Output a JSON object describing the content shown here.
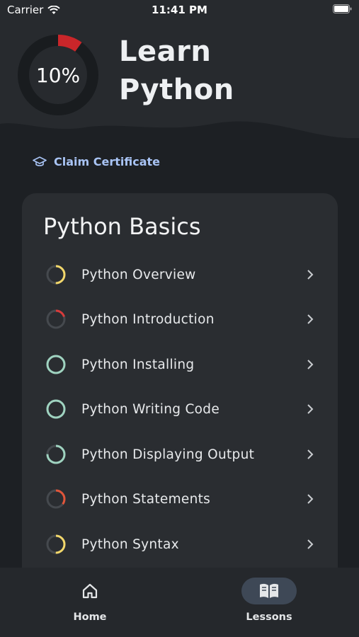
{
  "status_bar": {
    "carrier": "Carrier",
    "time": "11:41 PM"
  },
  "course": {
    "title_line1": "Learn",
    "title_line2": "Python",
    "progress_label": "10%",
    "progress": 0.1
  },
  "claim": {
    "label": "Claim Certificate"
  },
  "section": {
    "title": "Python Basics",
    "lessons": [
      {
        "label": "Python Overview",
        "progress": 0.5,
        "color": "#f2d76b"
      },
      {
        "label": "Python Introduction",
        "progress": 0.2,
        "color": "#d93b3b"
      },
      {
        "label": "Python Installing",
        "progress": 1.0,
        "color": "#9fd3c0"
      },
      {
        "label": "Python Writing Code",
        "progress": 1.0,
        "color": "#9fd3c0"
      },
      {
        "label": "Python Displaying Output",
        "progress": 0.75,
        "color": "#9fd3c0"
      },
      {
        "label": "Python Statements",
        "progress": 0.35,
        "color": "#e0553a"
      },
      {
        "label": "Python Syntax",
        "progress": 0.5,
        "color": "#f2d76b"
      }
    ]
  },
  "tabs": [
    {
      "label": "Home",
      "icon": "home-icon"
    },
    {
      "label": "Lessons",
      "icon": "book-icon",
      "active": true
    }
  ],
  "colors": {
    "accent": "#a9c4f5",
    "progress_red": "#c9262a"
  }
}
